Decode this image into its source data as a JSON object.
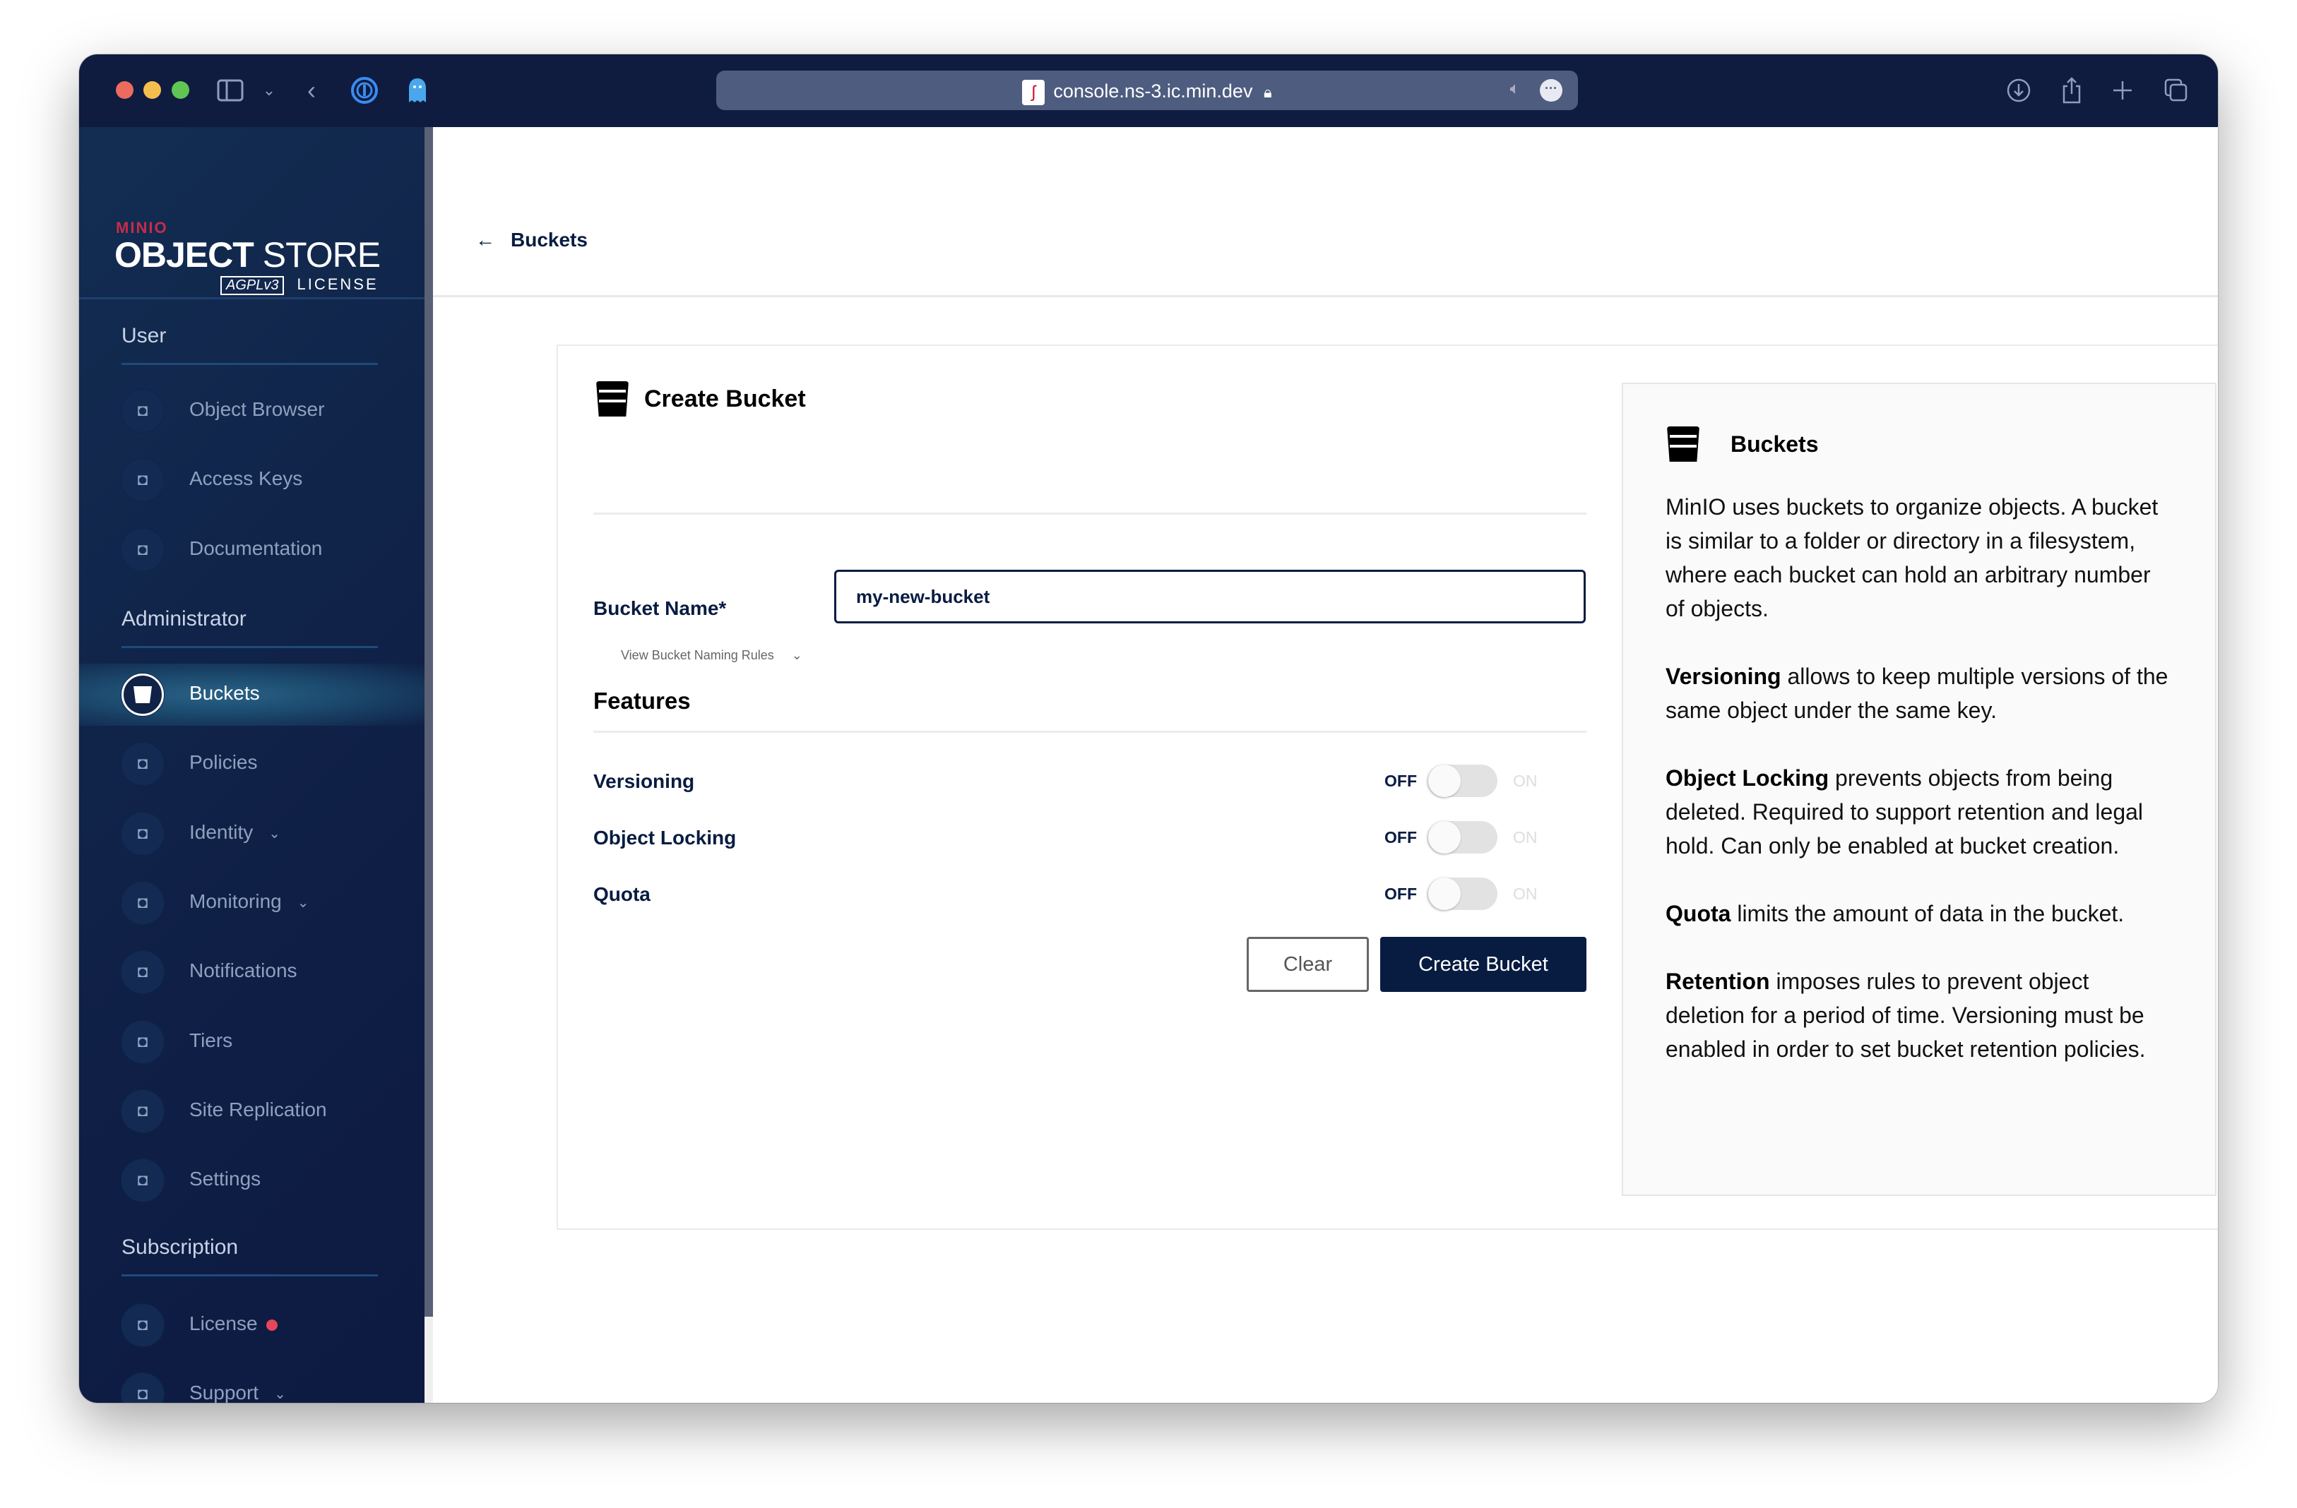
{
  "browser": {
    "url": "console.ns-3.ic.min.dev",
    "traffic_lights": {
      "close": "#ed6a5e",
      "minimize": "#f5bf4f",
      "zoom": "#61c554"
    },
    "icons": [
      "sidebar-toggle-icon",
      "chevron-down-icon",
      "back-icon",
      "onepassword-icon",
      "ghostery-icon",
      "lock-icon",
      "speaker-icon",
      "more-icon",
      "download-icon",
      "share-icon",
      "new-tab-icon",
      "tabs-overview-icon"
    ]
  },
  "logo": {
    "brand": "MINIO",
    "product_bold": "OBJECT",
    "product_light": "STORE",
    "badge": "AGPLv3",
    "license": "LICENSE"
  },
  "sidebar": {
    "sections": [
      {
        "title": "User",
        "items": [
          {
            "label": "Object Browser",
            "icon": "object-browser-icon"
          },
          {
            "label": "Access Keys",
            "icon": "access-keys-icon"
          },
          {
            "label": "Documentation",
            "icon": "documentation-icon"
          }
        ]
      },
      {
        "title": "Administrator",
        "items": [
          {
            "label": "Buckets",
            "icon": "bucket-icon",
            "active": true
          },
          {
            "label": "Policies",
            "icon": "policies-icon"
          },
          {
            "label": "Identity",
            "icon": "identity-icon",
            "expandable": true
          },
          {
            "label": "Monitoring",
            "icon": "monitoring-icon",
            "expandable": true
          },
          {
            "label": "Notifications",
            "icon": "lambda-icon"
          },
          {
            "label": "Tiers",
            "icon": "tiers-icon"
          },
          {
            "label": "Site Replication",
            "icon": "site-replication-icon"
          },
          {
            "label": "Settings",
            "icon": "settings-icon"
          }
        ]
      },
      {
        "title": "Subscription",
        "items": [
          {
            "label": "License",
            "icon": "license-icon",
            "alert": true
          },
          {
            "label": "Support",
            "icon": "support-icon",
            "expandable": true
          }
        ]
      }
    ]
  },
  "header": {
    "back_label": "Buckets"
  },
  "form": {
    "title": "Create Bucket",
    "bucket_name_label": "Bucket Name*",
    "bucket_name_value": "my-new-bucket",
    "naming_rules_link": "View Bucket Naming Rules",
    "features_title": "Features",
    "features": [
      {
        "label": "Versioning",
        "off": "OFF",
        "on": "ON",
        "enabled": false
      },
      {
        "label": "Object Locking",
        "off": "OFF",
        "on": "ON",
        "enabled": false
      },
      {
        "label": "Quota",
        "off": "OFF",
        "on": "ON",
        "enabled": false
      }
    ],
    "clear_label": "Clear",
    "create_label": "Create Bucket"
  },
  "help": {
    "title": "Buckets",
    "intro": "MinIO uses buckets to organize objects. A bucket is similar to a folder or directory in a filesystem, where each bucket can hold an arbitrary number of objects.",
    "entries": [
      {
        "term": "Versioning",
        "text": " allows to keep multiple versions of the same object under the same key."
      },
      {
        "term": "Object Locking",
        "text": " prevents objects from being deleted. Required to support retention and legal hold. Can only be enabled at bucket creation."
      },
      {
        "term": "Quota",
        "text": " limits the amount of data in the bucket."
      },
      {
        "term": "Retention",
        "text": " imposes rules to prevent object deletion for a period of time. Versioning must be enabled in order to set bucket retention policies."
      }
    ]
  },
  "colors": {
    "navy": "#081c42",
    "sidebar": "#0f1f45",
    "alert": "#e8465a",
    "brand_red": "#c72c48"
  }
}
